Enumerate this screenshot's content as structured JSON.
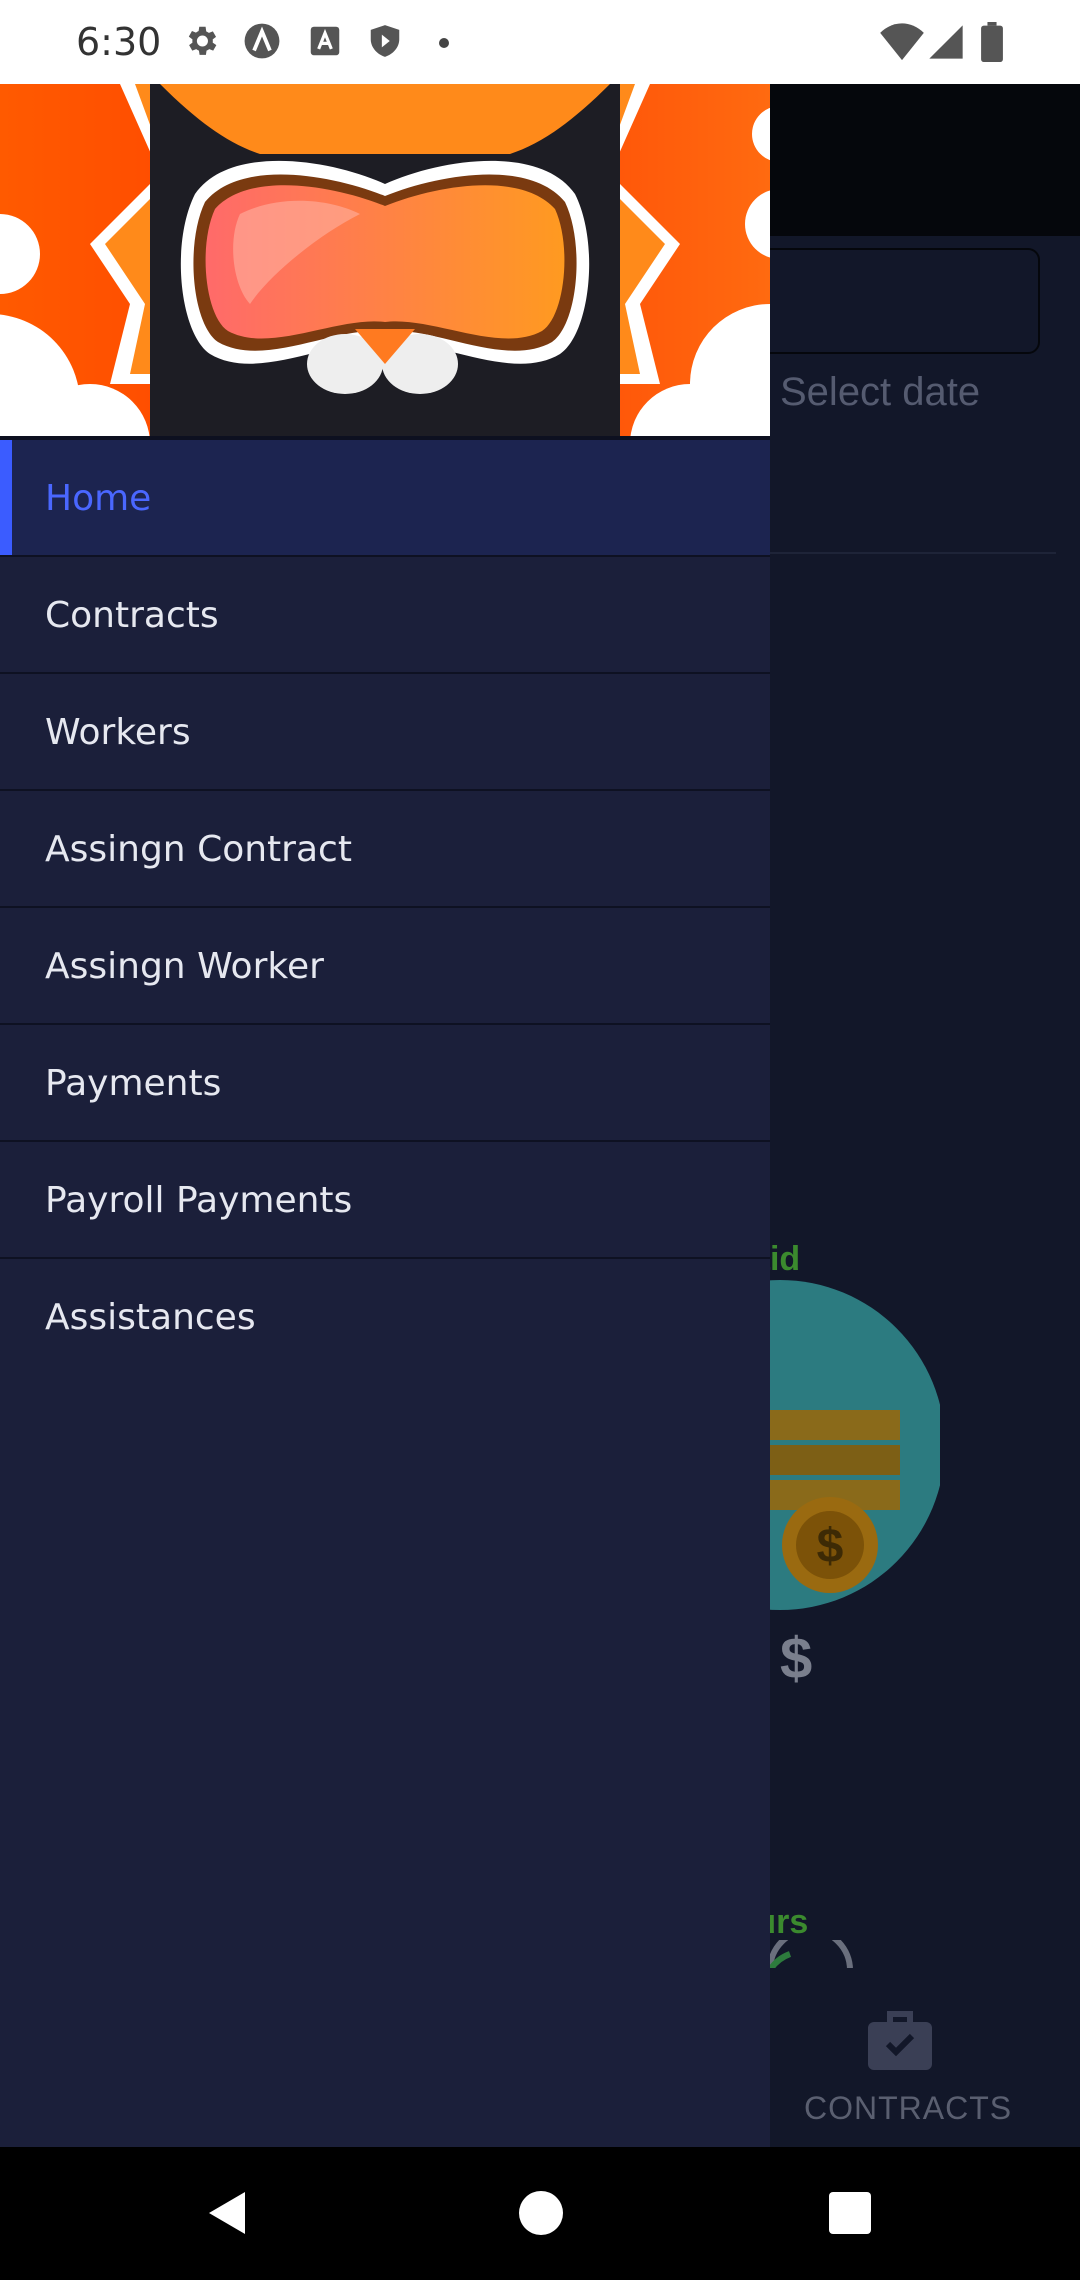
{
  "status_bar": {
    "time": "6:30",
    "icons": [
      "gear-icon",
      "lambda-icon",
      "a-icon",
      "shield-icon",
      "dot-icon",
      "wifi-icon",
      "signal-icon",
      "battery-icon"
    ]
  },
  "background": {
    "date_placeholder": "Select date",
    "paid_label": "y Paid",
    "currency_symbol": "$",
    "hours_label": "Hours",
    "bottom_nav_label": "CONTRACTS"
  },
  "drawer": {
    "menu": [
      {
        "label": "Home",
        "active": true
      },
      {
        "label": "Contracts",
        "active": false
      },
      {
        "label": "Workers",
        "active": false
      },
      {
        "label": "Assingn Contract",
        "active": false
      },
      {
        "label": "Assingn Worker",
        "active": false
      },
      {
        "label": "Payments",
        "active": false
      },
      {
        "label": "Payroll Payments",
        "active": false
      },
      {
        "label": "Assistances",
        "active": false
      }
    ]
  },
  "colors": {
    "drawer_bg": "#1b1f3a",
    "active_bg": "#1c2450",
    "accent": "#3b5cff",
    "active_text": "#4a67ff"
  }
}
